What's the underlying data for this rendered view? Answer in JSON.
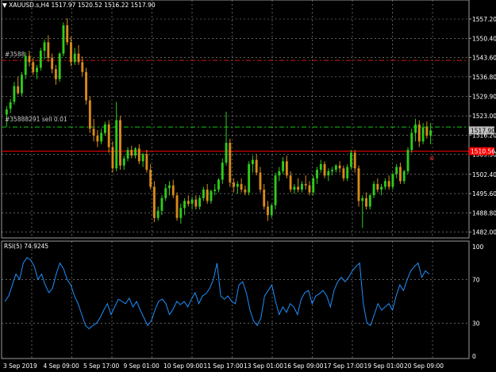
{
  "header": {
    "menu_glyph": "▼",
    "symbol_timeframe": "XAUUSD.s,H4",
    "ohlc": "1517.97 1520.52 1516.22 1517.90"
  },
  "orders": {
    "upper_line_label": "#3588",
    "lower_line_label": "#35888291 sell 0.01"
  },
  "price_axis": {
    "ticks": [
      "1557.20",
      "1550.40",
      "1543.60",
      "1536.80",
      "1529.90",
      "1523.00",
      "1516.20",
      "1509.50",
      "1502.40",
      "1495.60",
      "1488.80",
      "1482.00"
    ],
    "current_price": "1517.90",
    "sell_price": "1510.56",
    "current_price_color": "#c0c0c0",
    "sell_price_color": "#ff0000"
  },
  "rsi": {
    "title": "RSI(5) 74.9245",
    "levels": [
      "100",
      "70",
      "30",
      "0"
    ],
    "line_color": "#1e90ff"
  },
  "time_axis": {
    "labels": [
      "3 Sep 2019",
      "4 Sep 09:00",
      "5 Sep 17:00",
      "9 Sep 01:00",
      "10 Sep 09:00",
      "11 Sep 17:00",
      "13 Sep 01:00",
      "16 Sep 09:00",
      "17 Sep 17:00",
      "19 Sep 01:00",
      "20 Sep 09:00"
    ]
  },
  "colors": {
    "bull": "#2ecc1a",
    "bear": "#d98a1a",
    "grid": "#9a9a9a",
    "sell_line": "#ff0000",
    "sl_line": "#cc1a1a",
    "tp_line": "#14c814"
  },
  "chart_data": [
    {
      "type": "candlestick",
      "title": "XAUUSD.s,H4",
      "ylim": [
        1480.5,
        1560.0
      ],
      "y_ticks": [
        1557.2,
        1550.4,
        1543.6,
        1536.8,
        1529.9,
        1523.0,
        1516.2,
        1509.5,
        1502.4,
        1495.6,
        1488.8,
        1482.0
      ],
      "x_labels": [
        "3 Sep 2019",
        "4 Sep 09:00",
        "5 Sep 17:00",
        "9 Sep 01:00",
        "10 Sep 09:00",
        "11 Sep 17:00",
        "13 Sep 01:00",
        "16 Sep 09:00",
        "17 Sep 17:00",
        "19 Sep 01:00",
        "20 Sep 09:00"
      ],
      "levels": [
        {
          "name": "#3588",
          "value": 1542.6,
          "style": "dash-dot"
        },
        {
          "name": "#35888291 sell 0.01",
          "value": 1519.1,
          "style": "dash-dot"
        },
        {
          "name": "sell",
          "value": 1510.56,
          "style": "solid"
        }
      ],
      "candles": [
        [
          1523.5,
          1526.5,
          1519.2,
          1525.3
        ],
        [
          1525.5,
          1529.0,
          1524.0,
          1527.8
        ],
        [
          1528.0,
          1535.0,
          1527.0,
          1533.5
        ],
        [
          1533.5,
          1537.0,
          1530.5,
          1531.0
        ],
        [
          1531.0,
          1538.5,
          1530.0,
          1537.5
        ],
        [
          1537.5,
          1545.5,
          1536.0,
          1544.2
        ],
        [
          1544.2,
          1546.0,
          1540.5,
          1542.0
        ],
        [
          1542.0,
          1543.5,
          1537.5,
          1538.5
        ],
        [
          1538.5,
          1541.0,
          1536.0,
          1540.0
        ],
        [
          1540.0,
          1547.0,
          1539.0,
          1546.0
        ],
        [
          1546.0,
          1550.0,
          1543.0,
          1549.0
        ],
        [
          1549.0,
          1551.5,
          1542.0,
          1543.5
        ],
        [
          1543.5,
          1545.0,
          1538.0,
          1539.5
        ],
        [
          1539.5,
          1541.0,
          1534.0,
          1536.0
        ],
        [
          1536.0,
          1545.5,
          1535.0,
          1545.0
        ],
        [
          1545.0,
          1556.0,
          1544.0,
          1555.0
        ],
        [
          1555.0,
          1557.5,
          1548.0,
          1549.0
        ],
        [
          1549.0,
          1551.0,
          1540.5,
          1542.0
        ],
        [
          1542.0,
          1547.0,
          1541.0,
          1545.0
        ],
        [
          1545.0,
          1548.0,
          1541.0,
          1542.0
        ],
        [
          1542.0,
          1544.0,
          1537.0,
          1538.5
        ],
        [
          1538.5,
          1540.0,
          1527.0,
          1528.5
        ],
        [
          1528.5,
          1530.0,
          1517.0,
          1518.5
        ],
        [
          1518.5,
          1522.0,
          1514.0,
          1516.0
        ],
        [
          1516.0,
          1518.0,
          1512.0,
          1514.0
        ],
        [
          1514.0,
          1518.5,
          1513.0,
          1517.0
        ],
        [
          1517.0,
          1521.0,
          1516.0,
          1520.0
        ],
        [
          1520.0,
          1521.5,
          1510.0,
          1512.0
        ],
        [
          1512.0,
          1514.0,
          1503.0,
          1504.5
        ],
        [
          1504.5,
          1528.0,
          1503.5,
          1521.5
        ],
        [
          1521.5,
          1523.0,
          1504.0,
          1505.5
        ],
        [
          1505.5,
          1509.0,
          1504.0,
          1508.0
        ],
        [
          1508.0,
          1512.0,
          1507.0,
          1511.0
        ],
        [
          1511.0,
          1512.5,
          1508.0,
          1509.0
        ],
        [
          1509.0,
          1512.0,
          1508.0,
          1511.5
        ],
        [
          1511.5,
          1513.0,
          1506.0,
          1507.0
        ],
        [
          1507.0,
          1510.0,
          1505.0,
          1509.5
        ],
        [
          1509.5,
          1511.0,
          1503.0,
          1504.0
        ],
        [
          1504.0,
          1506.0,
          1497.0,
          1498.0
        ],
        [
          1498.0,
          1500.0,
          1485.5,
          1487.0
        ],
        [
          1487.0,
          1491.0,
          1486.0,
          1489.5
        ],
        [
          1489.5,
          1495.0,
          1488.0,
          1494.0
        ],
        [
          1494.0,
          1499.0,
          1493.0,
          1497.5
        ],
        [
          1497.5,
          1500.0,
          1495.0,
          1498.5
        ],
        [
          1498.5,
          1500.5,
          1494.0,
          1495.0
        ],
        [
          1495.0,
          1496.0,
          1486.0,
          1487.0
        ],
        [
          1487.0,
          1492.0,
          1485.0,
          1490.5
        ],
        [
          1490.5,
          1494.0,
          1488.0,
          1493.0
        ],
        [
          1493.0,
          1495.0,
          1491.0,
          1492.0
        ],
        [
          1492.0,
          1494.5,
          1490.0,
          1493.5
        ],
        [
          1493.5,
          1495.0,
          1490.0,
          1491.0
        ],
        [
          1491.0,
          1495.0,
          1490.0,
          1494.0
        ],
        [
          1494.0,
          1498.0,
          1493.0,
          1497.0
        ],
        [
          1497.0,
          1499.0,
          1492.0,
          1493.0
        ],
        [
          1493.0,
          1497.0,
          1492.0,
          1496.5
        ],
        [
          1496.5,
          1499.0,
          1495.0,
          1497.0
        ],
        [
          1497.0,
          1501.0,
          1496.0,
          1500.5
        ],
        [
          1500.5,
          1508.0,
          1499.0,
          1506.5
        ],
        [
          1506.5,
          1524.5,
          1505.5,
          1513.5
        ],
        [
          1513.5,
          1515.0,
          1498.0,
          1499.5
        ],
        [
          1499.5,
          1501.0,
          1496.0,
          1498.0
        ],
        [
          1498.0,
          1500.0,
          1495.5,
          1499.0
        ],
        [
          1499.0,
          1501.0,
          1496.0,
          1497.0
        ],
        [
          1497.0,
          1498.5,
          1495.0,
          1496.0
        ],
        [
          1496.0,
          1507.0,
          1495.0,
          1506.0
        ],
        [
          1506.0,
          1509.0,
          1503.0,
          1507.5
        ],
        [
          1507.5,
          1509.5,
          1502.0,
          1503.0
        ],
        [
          1503.0,
          1505.0,
          1496.0,
          1497.0
        ],
        [
          1497.0,
          1499.0,
          1490.0,
          1491.0
        ],
        [
          1491.0,
          1493.0,
          1486.0,
          1488.0
        ],
        [
          1488.0,
          1492.0,
          1487.0,
          1491.5
        ],
        [
          1491.5,
          1503.0,
          1490.0,
          1502.0
        ],
        [
          1502.0,
          1505.0,
          1500.0,
          1503.5
        ],
        [
          1503.5,
          1508.5,
          1502.5,
          1507.0
        ],
        [
          1507.0,
          1509.0,
          1501.0,
          1502.0
        ],
        [
          1502.0,
          1503.5,
          1496.0,
          1497.0
        ],
        [
          1497.0,
          1499.0,
          1495.5,
          1498.0
        ],
        [
          1498.0,
          1501.0,
          1496.0,
          1497.0
        ],
        [
          1497.0,
          1500.0,
          1496.0,
          1499.0
        ],
        [
          1499.0,
          1502.0,
          1497.0,
          1498.5
        ],
        [
          1498.5,
          1500.0,
          1495.0,
          1496.0
        ],
        [
          1496.0,
          1502.0,
          1495.0,
          1501.0
        ],
        [
          1501.0,
          1505.0,
          1499.0,
          1504.0
        ],
        [
          1504.0,
          1507.5,
          1503.0,
          1506.0
        ],
        [
          1506.0,
          1507.0,
          1501.0,
          1502.0
        ],
        [
          1502.0,
          1504.5,
          1500.0,
          1503.5
        ],
        [
          1503.5,
          1505.0,
          1502.0,
          1504.0
        ],
        [
          1504.0,
          1506.0,
          1503.0,
          1505.5
        ],
        [
          1505.5,
          1507.0,
          1503.0,
          1504.5
        ],
        [
          1504.5,
          1505.5,
          1500.0,
          1501.0
        ],
        [
          1501.0,
          1506.0,
          1500.0,
          1505.0
        ],
        [
          1505.0,
          1511.0,
          1504.0,
          1510.0
        ],
        [
          1510.0,
          1511.0,
          1503.0,
          1504.5
        ],
        [
          1504.5,
          1505.5,
          1491.0,
          1493.0
        ],
        [
          1493.0,
          1495.0,
          1483.5,
          1494.0
        ],
        [
          1494.0,
          1496.0,
          1490.0,
          1491.0
        ],
        [
          1491.0,
          1495.5,
          1490.0,
          1495.0
        ],
        [
          1495.0,
          1500.0,
          1494.0,
          1499.0
        ],
        [
          1499.0,
          1501.0,
          1496.0,
          1497.0
        ],
        [
          1497.0,
          1499.0,
          1495.0,
          1498.0
        ],
        [
          1498.0,
          1501.0,
          1497.0,
          1500.0
        ],
        [
          1500.0,
          1502.0,
          1497.0,
          1498.0
        ],
        [
          1498.0,
          1503.0,
          1497.0,
          1502.5
        ],
        [
          1502.5,
          1506.0,
          1501.0,
          1505.0
        ],
        [
          1505.0,
          1506.5,
          1499.0,
          1500.0
        ],
        [
          1500.0,
          1504.0,
          1499.0,
          1503.5
        ],
        [
          1503.5,
          1512.0,
          1502.5,
          1511.0
        ],
        [
          1511.0,
          1518.5,
          1510.0,
          1517.0
        ],
        [
          1517.0,
          1522.0,
          1514.0,
          1520.0
        ],
        [
          1520.0,
          1521.5,
          1512.0,
          1514.0
        ],
        [
          1514.0,
          1520.5,
          1513.0,
          1519.0
        ],
        [
          1519.0,
          1521.0,
          1515.0,
          1516.0
        ],
        [
          1516.0,
          1520.5,
          1513.0,
          1517.9
        ]
      ]
    },
    {
      "type": "line",
      "title": "RSI(5) 74.9245",
      "ylim": [
        0,
        100
      ],
      "y_ticks": [
        100,
        70,
        30,
        0
      ],
      "series": [
        {
          "name": "RSI(5)",
          "values": [
            50,
            55,
            65,
            75,
            70,
            85,
            90,
            88,
            82,
            70,
            75,
            65,
            58,
            62,
            75,
            85,
            80,
            70,
            65,
            55,
            48,
            38,
            28,
            25,
            28,
            30,
            35,
            42,
            48,
            38,
            45,
            52,
            50,
            48,
            53,
            45,
            50,
            42,
            35,
            28,
            32,
            42,
            50,
            52,
            48,
            38,
            43,
            50,
            47,
            50,
            45,
            52,
            58,
            48,
            55,
            57,
            62,
            70,
            85,
            55,
            52,
            55,
            50,
            48,
            65,
            68,
            58,
            42,
            32,
            28,
            35,
            55,
            60,
            65,
            50,
            38,
            45,
            40,
            48,
            45,
            38,
            52,
            58,
            60,
            48,
            55,
            57,
            60,
            55,
            45,
            60,
            68,
            72,
            68,
            72,
            78,
            82,
            85,
            48,
            30,
            28,
            38,
            48,
            42,
            45,
            48,
            42,
            55,
            65,
            60,
            70,
            78,
            82,
            85,
            72,
            78,
            74.9
          ]
        }
      ]
    }
  ]
}
